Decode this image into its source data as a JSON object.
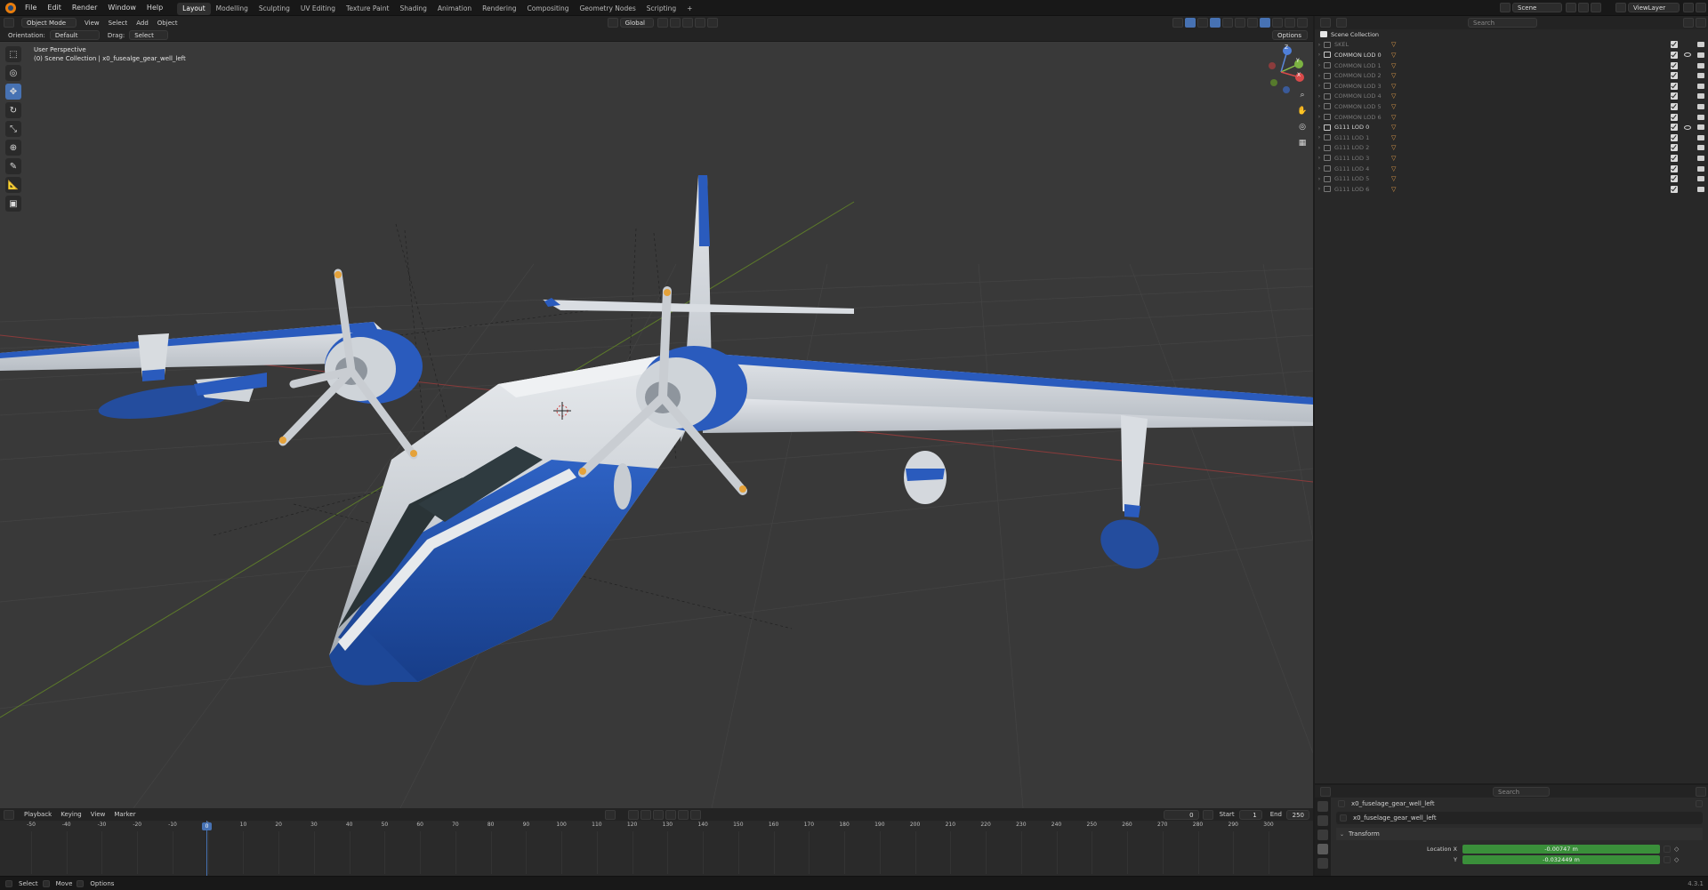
{
  "topbar": {
    "menus": [
      "File",
      "Edit",
      "Render",
      "Window",
      "Help"
    ],
    "workspaces": [
      "Layout",
      "Modelling",
      "Sculpting",
      "UV Editing",
      "Texture Paint",
      "Shading",
      "Animation",
      "Rendering",
      "Compositing",
      "Geometry Nodes",
      "Scripting"
    ],
    "active_workspace": "Layout",
    "add_tab": "+",
    "scene_label": "Scene",
    "viewlayer_label": "ViewLayer"
  },
  "viewport_header": {
    "mode": "Object Mode",
    "menus": [
      "View",
      "Select",
      "Add",
      "Object"
    ],
    "transform_orientation": "Global",
    "options": "Options"
  },
  "tool_header": {
    "orientation_label": "Orientation:",
    "orientation_value": "Default",
    "drag_label": "Drag:",
    "drag_value": "Select Box"
  },
  "viewport": {
    "perspective": "User Perspective",
    "collection_info": "(0) Scene Collection | x0_fusealge_gear_well_left",
    "gizmo_axes": [
      "Z",
      "Y",
      "X"
    ]
  },
  "timeline": {
    "menus": [
      "Playback",
      "Keying",
      "View",
      "Marker"
    ],
    "current_frame": "0",
    "start_label": "Start",
    "start_value": "1",
    "end_label": "End",
    "end_value": "250",
    "ticks": [
      "-50",
      "-40",
      "-30",
      "-20",
      "-10",
      "0",
      "10",
      "20",
      "30",
      "40",
      "50",
      "60",
      "70",
      "80",
      "90",
      "100",
      "110",
      "120",
      "130",
      "140",
      "150",
      "160",
      "170",
      "180",
      "190",
      "200",
      "210",
      "220",
      "230",
      "240",
      "250",
      "260",
      "270",
      "280",
      "290",
      "300"
    ]
  },
  "statusbar": {
    "items": [
      "Select",
      "Move",
      "Options"
    ],
    "version": "4.3.1"
  },
  "outliner": {
    "search_placeholder": "Search",
    "root": "Scene Collection",
    "items": [
      {
        "name": "SKEL",
        "dim": true,
        "eye": false
      },
      {
        "name": "COMMON LOD 0",
        "dim": false,
        "eye": true
      },
      {
        "name": "COMMON LOD 1",
        "dim": true,
        "eye": false
      },
      {
        "name": "COMMON LOD 2",
        "dim": true,
        "eye": false
      },
      {
        "name": "COMMON LOD 3",
        "dim": true,
        "eye": false
      },
      {
        "name": "COMMON LOD 4",
        "dim": true,
        "eye": false
      },
      {
        "name": "COMMON LOD 5",
        "dim": true,
        "eye": false
      },
      {
        "name": "COMMON LOD 6",
        "dim": true,
        "eye": false
      },
      {
        "name": "G111 LOD 0",
        "dim": false,
        "eye": true
      },
      {
        "name": "G111 LOD 1",
        "dim": true,
        "eye": false
      },
      {
        "name": "G111 LOD 2",
        "dim": true,
        "eye": false
      },
      {
        "name": "G111 LOD 3",
        "dim": true,
        "eye": false
      },
      {
        "name": "G111 LOD 4",
        "dim": true,
        "eye": false
      },
      {
        "name": "G111 LOD 5",
        "dim": true,
        "eye": false
      },
      {
        "name": "G111 LOD 6",
        "dim": true,
        "eye": false
      }
    ]
  },
  "properties": {
    "search_placeholder": "Search",
    "object_name": "x0_fuselage_gear_well_left",
    "data_name": "x0_fuselage_gear_well_left",
    "panel": "Transform",
    "location_x_label": "Location X",
    "location_x": "-0.00747 m",
    "location_y_label": "Y",
    "location_y": "-0.032449 m"
  },
  "colors": {
    "accent": "#4772b3",
    "viewport_bg": "#393939",
    "field_green": "#3a8f3a",
    "aircraft_blue": "#1f4fa8",
    "aircraft_white": "#d9dde2"
  }
}
